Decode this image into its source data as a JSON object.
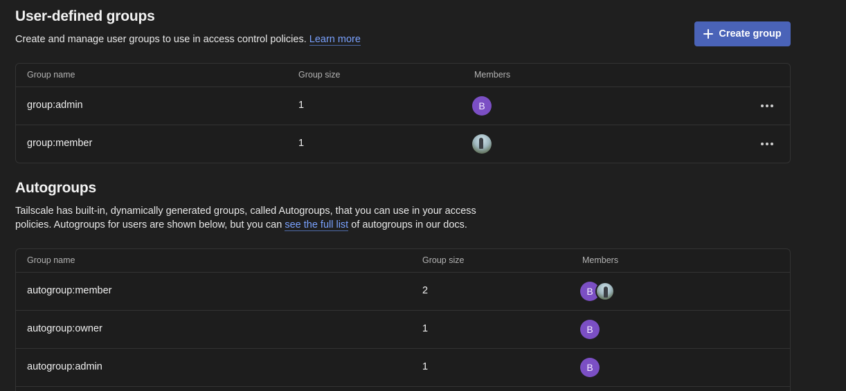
{
  "user_groups": {
    "title": "User-defined groups",
    "description": "Create and manage user groups to use in access control policies.",
    "learn_more": "Learn more",
    "create_button": "Create group",
    "columns": [
      "Group name",
      "Group size",
      "Members"
    ],
    "rows": [
      {
        "name": "group:admin",
        "size": "1",
        "avatar_letter": "B"
      },
      {
        "name": "group:member",
        "size": "1"
      }
    ]
  },
  "autogroups": {
    "title": "Autogroups",
    "description_line1": "Tailscale has built-in, dynamically generated groups, called Autogroups, that you can use in your access",
    "description_prefix": "policies. Autogroups for users are shown below, but you can",
    "full_list_link": "see the full list",
    "description_suffix": "of autogroups in our docs.",
    "columns": [
      "Group name",
      "Group size",
      "Members"
    ],
    "rows": [
      {
        "name": "autogroup:member",
        "size": "2",
        "avatar_letter": "B"
      },
      {
        "name": "autogroup:owner",
        "size": "1",
        "avatar_letter": "B"
      },
      {
        "name": "autogroup:admin",
        "size": "1",
        "avatar_letter": "B"
      }
    ]
  },
  "colors": {
    "background": "#1f1f1f",
    "accent_button": "#4a63b8",
    "link": "#7aa2ff",
    "avatar": "#7b4fc4"
  },
  "icons": {
    "create": "plus-icon",
    "row_menu": "more-horizontal-icon"
  }
}
